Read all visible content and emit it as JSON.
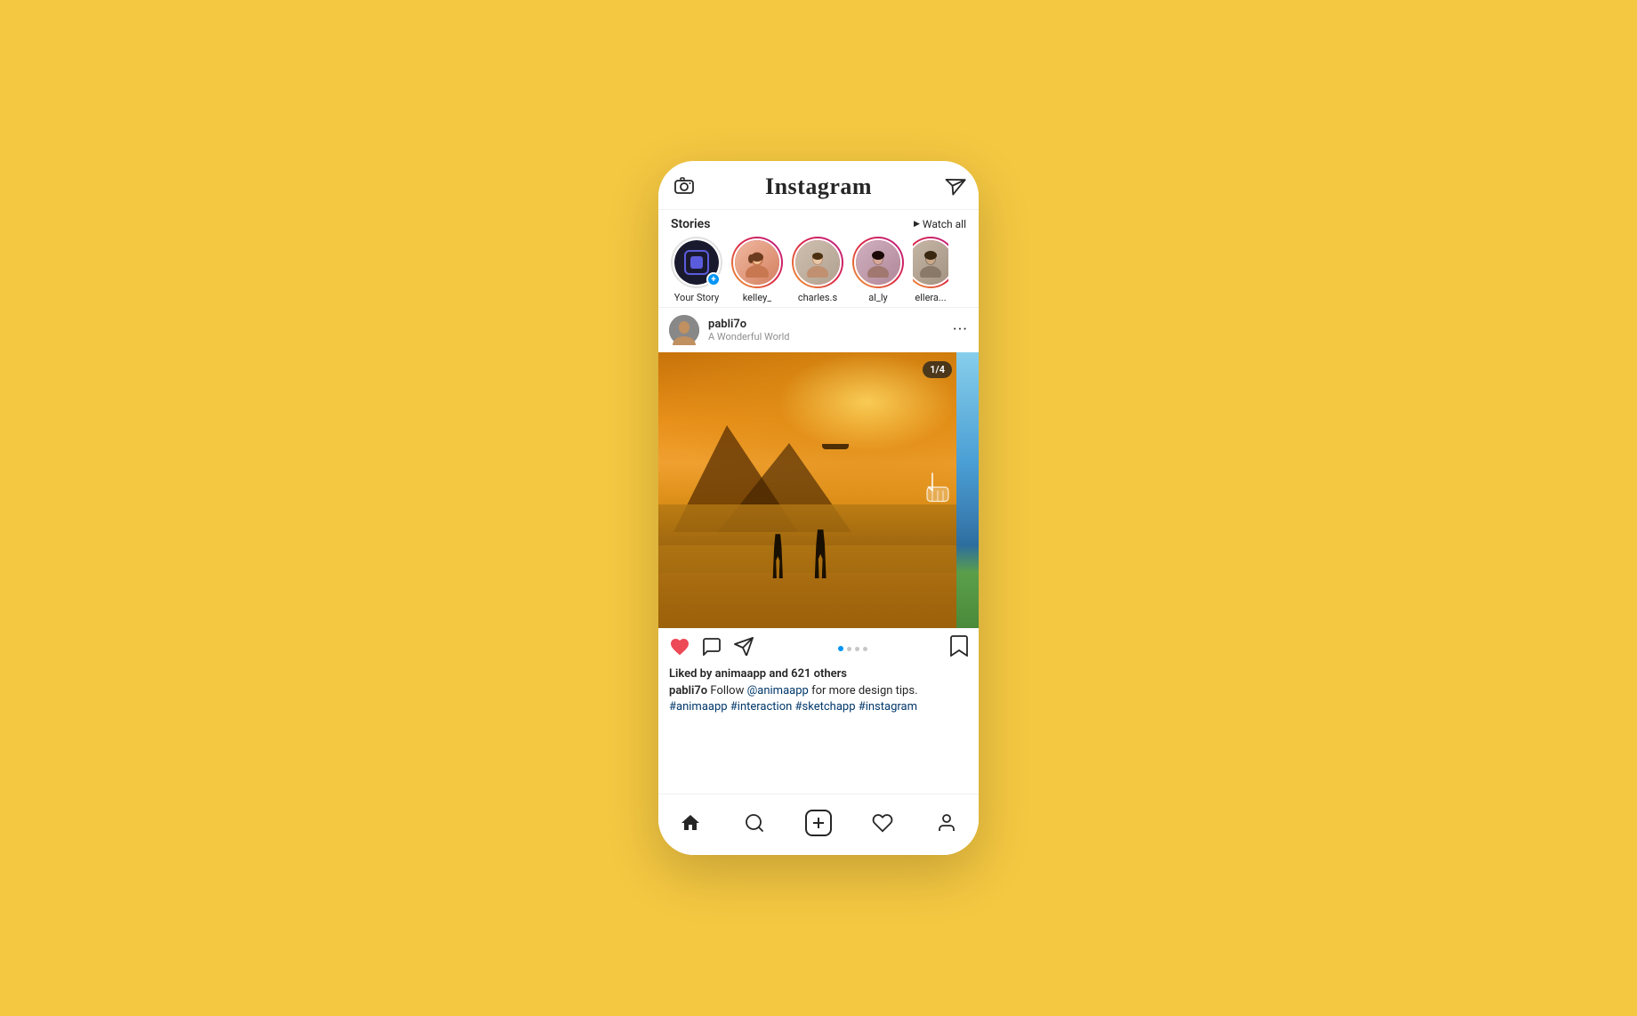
{
  "background_color": "#F5C842",
  "phone": {
    "header": {
      "title": "Instagram",
      "camera_icon": "📷",
      "send_icon": "send"
    },
    "stories": {
      "label": "Stories",
      "watch_all": "Watch all",
      "items": [
        {
          "id": "your-story",
          "username": "Your Story",
          "type": "self",
          "color": "#1a1a2e"
        },
        {
          "id": "kelley",
          "username": "kelley_",
          "type": "friend",
          "color_a": "#f5a0a0",
          "color_b": "#e88"
        },
        {
          "id": "charles",
          "username": "charles.s",
          "type": "friend",
          "color_a": "#a0c4f5",
          "color_b": "#88a8e8"
        },
        {
          "id": "aly",
          "username": "al_ly",
          "type": "friend",
          "color_a": "#c4a0f5",
          "color_b": "#a888e8"
        },
        {
          "id": "ella",
          "username": "ellera...",
          "type": "friend",
          "color_a": "#d4d4d4",
          "color_b": "#aaa"
        }
      ]
    },
    "post": {
      "username": "pabli7o",
      "subtitle": "A Wonderful World",
      "image_counter": "1/4",
      "likes_text": "Liked by animaapp and 621 others",
      "caption_user": "pabli7o",
      "caption_action": " Follow ",
      "caption_mention": "@animaapp",
      "caption_text": " for more design tips.",
      "hashtags": "#animaapp #interaction #sketchapp #instagram",
      "dot_count": 4,
      "active_dot": 0
    },
    "bottom_nav": {
      "items": [
        "home",
        "search",
        "add",
        "heart",
        "profile"
      ]
    }
  }
}
